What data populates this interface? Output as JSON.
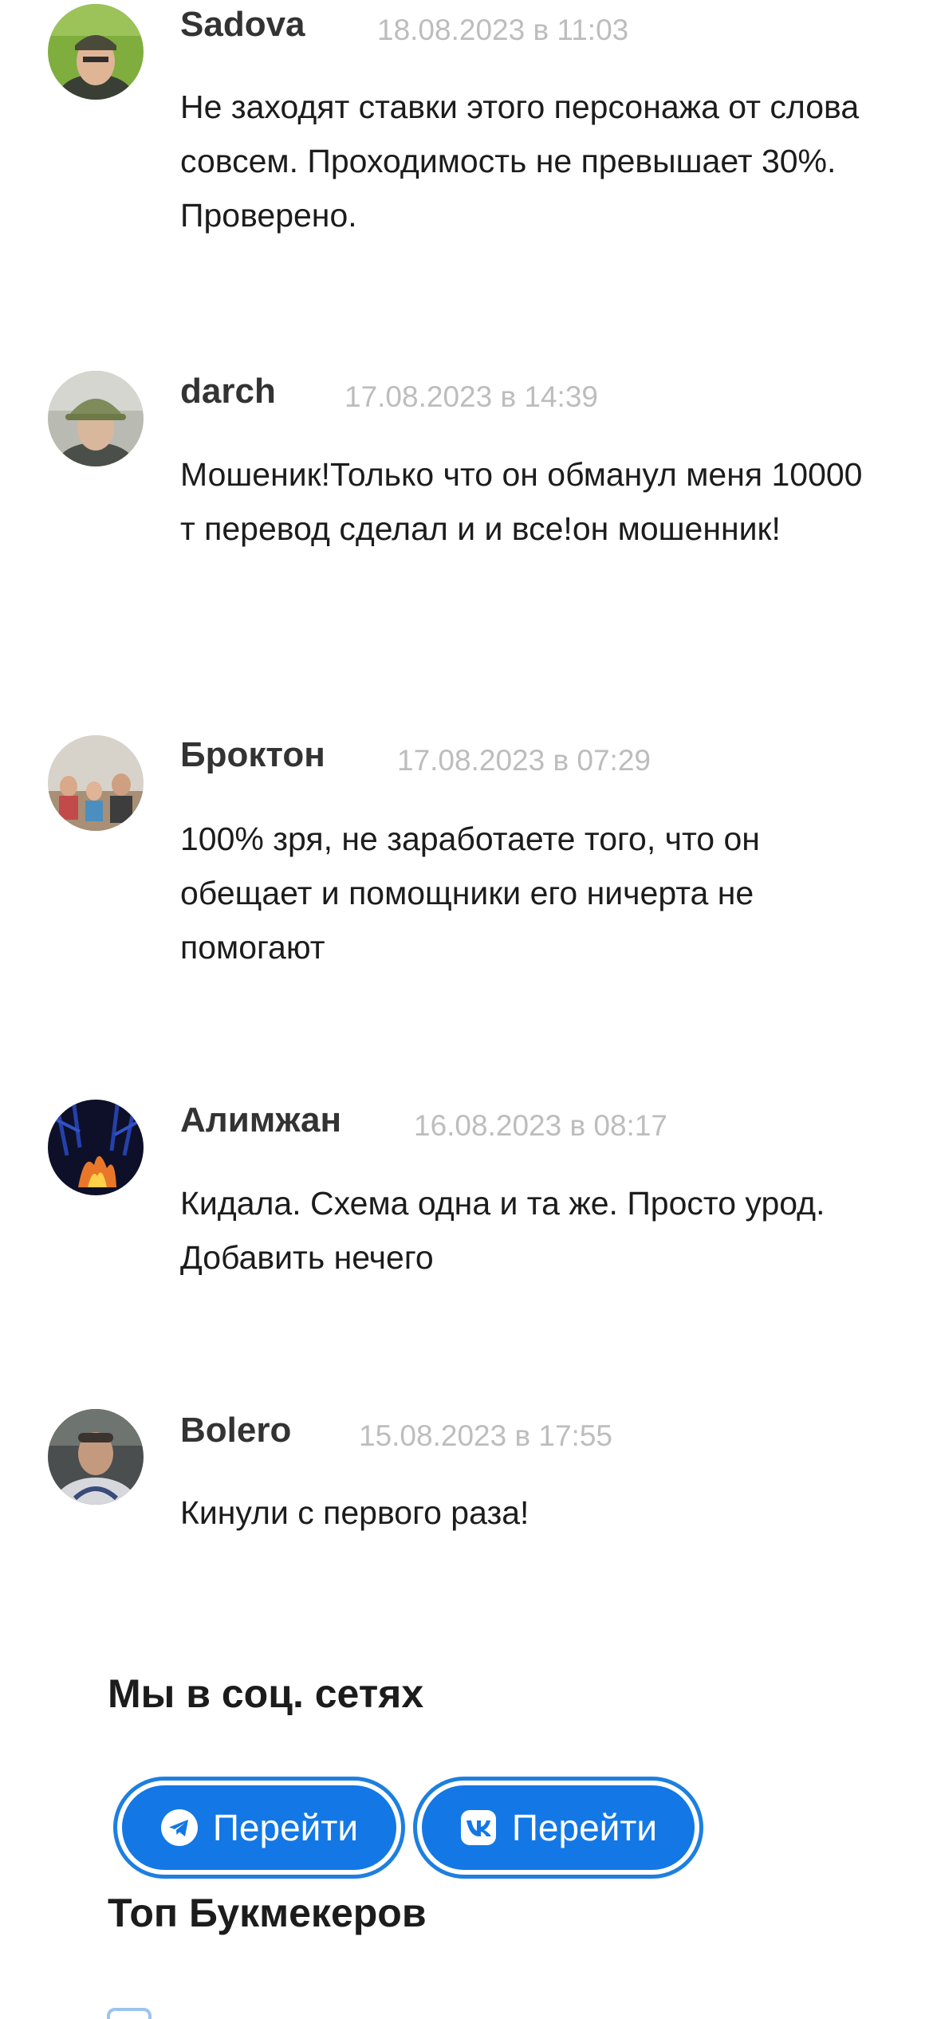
{
  "comments": [
    {
      "author": "Sadova",
      "date": "18.08.2023 в 11:03",
      "text": "Не заходят ставки этого персонажа от слова совсем. Проходимость не превышает 30%. Проверено."
    },
    {
      "author": "darch",
      "date": "17.08.2023 в 14:39",
      "text": "Мошеник!Только что он обманул меня 10000 т перевод сделал и и все!он мошенник!"
    },
    {
      "author": "Броктон",
      "date": "17.08.2023 в 07:29",
      "text": "100% зря, не заработаете того, что он обещает и помощники его ничерта не помогают"
    },
    {
      "author": "Алимжан",
      "date": "16.08.2023 в 08:17",
      "text": "Кидала. Схема одна и та же. Просто урод. Добавить нечего"
    },
    {
      "author": "Bolero",
      "date": "15.08.2023 в 17:55",
      "text": "Кинули с первого раза!"
    }
  ],
  "social": {
    "title": "Мы в соц. сетях",
    "telegram_label": "Перейти",
    "vk_label": "Перейти",
    "telegram_icon": "telegram-icon",
    "vk_icon": "vk-icon",
    "accent_color": "#1378e6"
  },
  "bookmakers": {
    "title": "Топ Букмекеров"
  }
}
